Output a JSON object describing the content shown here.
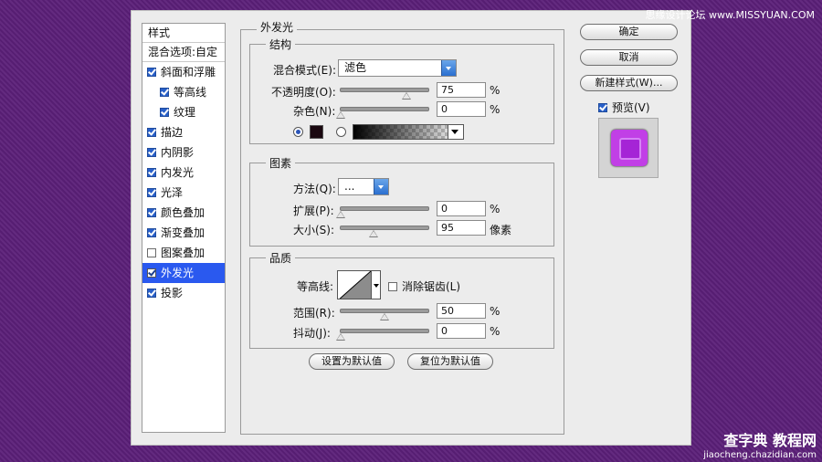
{
  "styles_panel": {
    "header": "样式",
    "blend_options": "混合选项:自定",
    "items": [
      {
        "label": "斜面和浮雕",
        "checked": true,
        "sub": false,
        "selected": false
      },
      {
        "label": "等高线",
        "checked": true,
        "sub": true,
        "selected": false
      },
      {
        "label": "纹理",
        "checked": true,
        "sub": true,
        "selected": false
      },
      {
        "label": "描边",
        "checked": true,
        "sub": false,
        "selected": false
      },
      {
        "label": "内阴影",
        "checked": true,
        "sub": false,
        "selected": false
      },
      {
        "label": "内发光",
        "checked": true,
        "sub": false,
        "selected": false
      },
      {
        "label": "光泽",
        "checked": true,
        "sub": false,
        "selected": false
      },
      {
        "label": "颜色叠加",
        "checked": true,
        "sub": false,
        "selected": false
      },
      {
        "label": "渐变叠加",
        "checked": true,
        "sub": false,
        "selected": false
      },
      {
        "label": "图案叠加",
        "checked": false,
        "sub": false,
        "selected": false
      },
      {
        "label": "外发光",
        "checked": true,
        "sub": false,
        "selected": true
      },
      {
        "label": "投影",
        "checked": true,
        "sub": false,
        "selected": false
      }
    ]
  },
  "outer_glow": {
    "title": "外发光",
    "structure": {
      "title": "结构",
      "blend_mode_label": "混合模式(E):",
      "blend_mode_value": "滤色",
      "opacity_label": "不透明度(O):",
      "opacity_value": "75",
      "opacity_fraction": 0.75,
      "noise_label": "杂色(N):",
      "noise_value": "0",
      "noise_fraction": 0,
      "percent": "%",
      "color_hex": "#000000"
    },
    "elements": {
      "title": "图素",
      "method_label": "方法(Q):",
      "method_value": "...",
      "spread_label": "扩展(P):",
      "spread_value": "0",
      "spread_fraction": 0,
      "size_label": "大小(S):",
      "size_value": "95",
      "size_fraction": 0.38,
      "size_unit": "像素",
      "percent": "%"
    },
    "quality": {
      "title": "品质",
      "contour_label": "等高线:",
      "antialias_label": "消除锯齿(L)",
      "antialias_checked": false,
      "range_label": "范围(R):",
      "range_value": "50",
      "range_fraction": 0.5,
      "jitter_label": "抖动(J):",
      "jitter_value": "0",
      "jitter_fraction": 0,
      "percent": "%"
    },
    "set_default": "设置为默认值",
    "reset_default": "复位为默认值"
  },
  "buttons": {
    "ok": "确定",
    "cancel": "取消",
    "new_style": "新建样式(W)...",
    "preview_label": "预览(V)",
    "preview_checked": true
  },
  "watermarks": {
    "top": "思缘设计论坛 www.MISSYUAN.COM",
    "bottom_big": "查字典 教程网",
    "bottom_small": "jiaocheng.chazidian.com"
  }
}
